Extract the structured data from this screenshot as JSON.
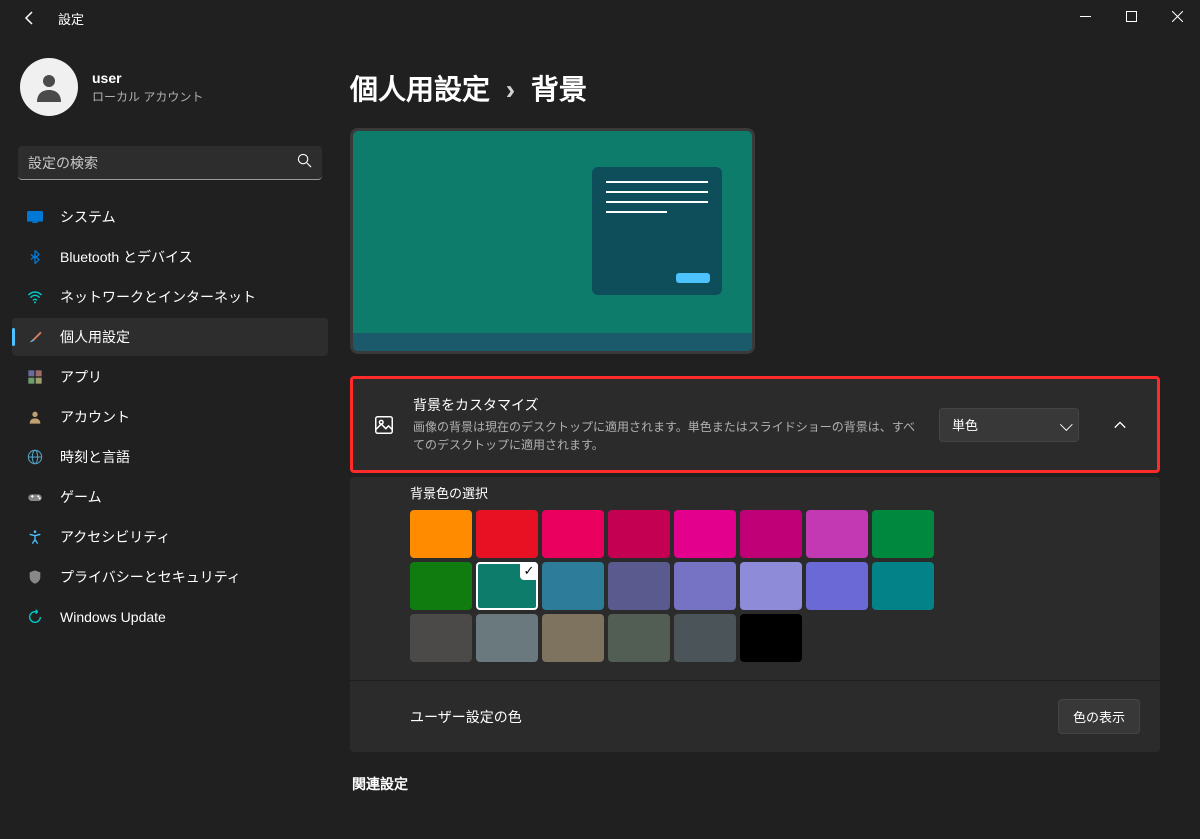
{
  "app": {
    "title": "設定"
  },
  "window_controls": {
    "min": "—",
    "max": "▢",
    "close": "✕"
  },
  "profile": {
    "username": "user",
    "account_type": "ローカル アカウント"
  },
  "search": {
    "placeholder": "設定の検索"
  },
  "nav": {
    "items": [
      {
        "label": "システム",
        "icon": "display"
      },
      {
        "label": "Bluetooth とデバイス",
        "icon": "bluetooth"
      },
      {
        "label": "ネットワークとインターネット",
        "icon": "wifi"
      },
      {
        "label": "個人用設定",
        "icon": "brush",
        "selected": true
      },
      {
        "label": "アプリ",
        "icon": "apps"
      },
      {
        "label": "アカウント",
        "icon": "person"
      },
      {
        "label": "時刻と言語",
        "icon": "globe"
      },
      {
        "label": "ゲーム",
        "icon": "game"
      },
      {
        "label": "アクセシビリティ",
        "icon": "accessibility"
      },
      {
        "label": "プライバシーとセキュリティ",
        "icon": "shield"
      },
      {
        "label": "Windows Update",
        "icon": "update"
      }
    ]
  },
  "breadcrumb": {
    "parent": "個人用設定",
    "separator": "›",
    "current": "背景"
  },
  "customize": {
    "title": "背景をカスタマイズ",
    "description": "画像の背景は現在のデスクトップに適用されます。単色またはスライドショーの背景は、すべてのデスクトップに適用されます。",
    "dropdown_value": "単色"
  },
  "colors": {
    "label": "背景色の選択",
    "swatches": [
      "#ff8c00",
      "#e81123",
      "#ea005e",
      "#c30052",
      "#e3008c",
      "#bf0077",
      "#c239b3",
      "#00893e",
      "#107c10",
      "#0e7c6b",
      "#2d7d9a",
      "#5a5a8f",
      "#7673c4",
      "#8e8cd8",
      "#6b69d6",
      "#038387",
      "#4c4a48",
      "#69797e",
      "#7e735f",
      "#525e54",
      "#4a5459",
      "#000000"
    ],
    "selected_index": 9
  },
  "custom_color": {
    "label": "ユーザー設定の色",
    "button": "色の表示"
  },
  "related": {
    "title": "関連設定"
  }
}
